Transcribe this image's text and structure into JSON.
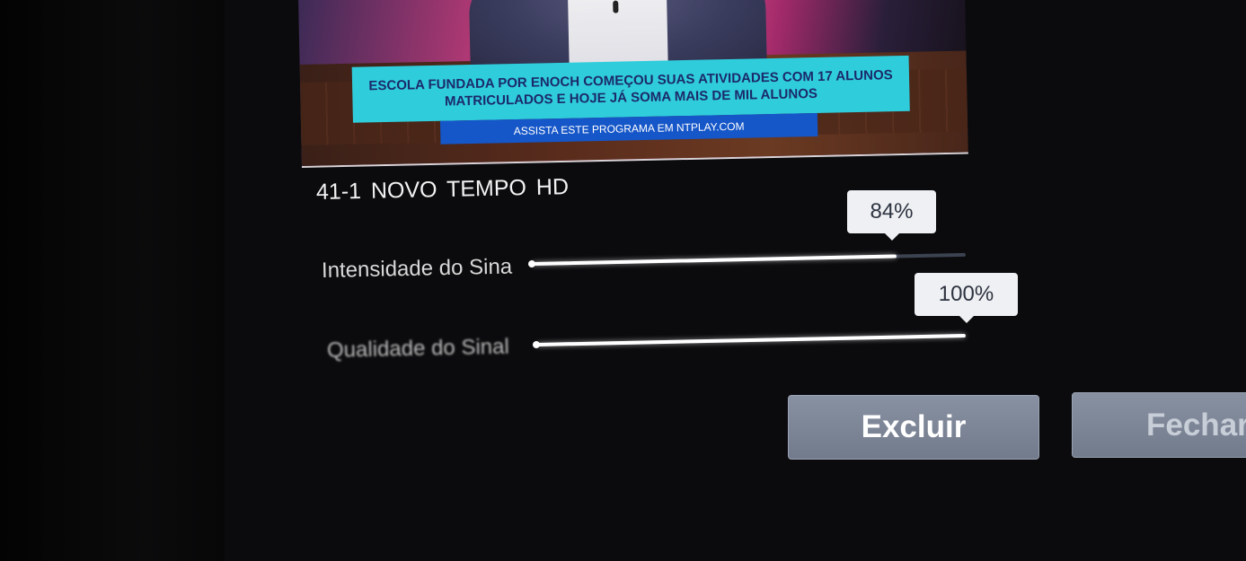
{
  "preview": {
    "banner_line1": "ESCOLA FUNDADA POR ENOCH COMEÇOU SUAS ATIVIDADES COM 17 ALUNOS",
    "banner_line2": "MATRICULADOS E HOJE JÁ SOMA MAIS DE MIL ALUNOS",
    "banner_sub": "ASSISTA ESTE PROGRAMA EM NTPLAY.COM"
  },
  "channel": {
    "label": "41-1  NOVO TEMPO HD"
  },
  "signal_strength": {
    "label": "Intensidade do Sina",
    "value_text": "84%",
    "value": 0.84
  },
  "signal_quality": {
    "label": "Qualidade do Sinal",
    "value_text": "100%",
    "value": 1.0
  },
  "buttons": {
    "delete": "Excluir",
    "close": "Fechar"
  },
  "colors": {
    "banner": "#2fcddc",
    "banner_sub": "#1556c8",
    "button": "#7d8697",
    "bubble": "#eef0f3"
  }
}
